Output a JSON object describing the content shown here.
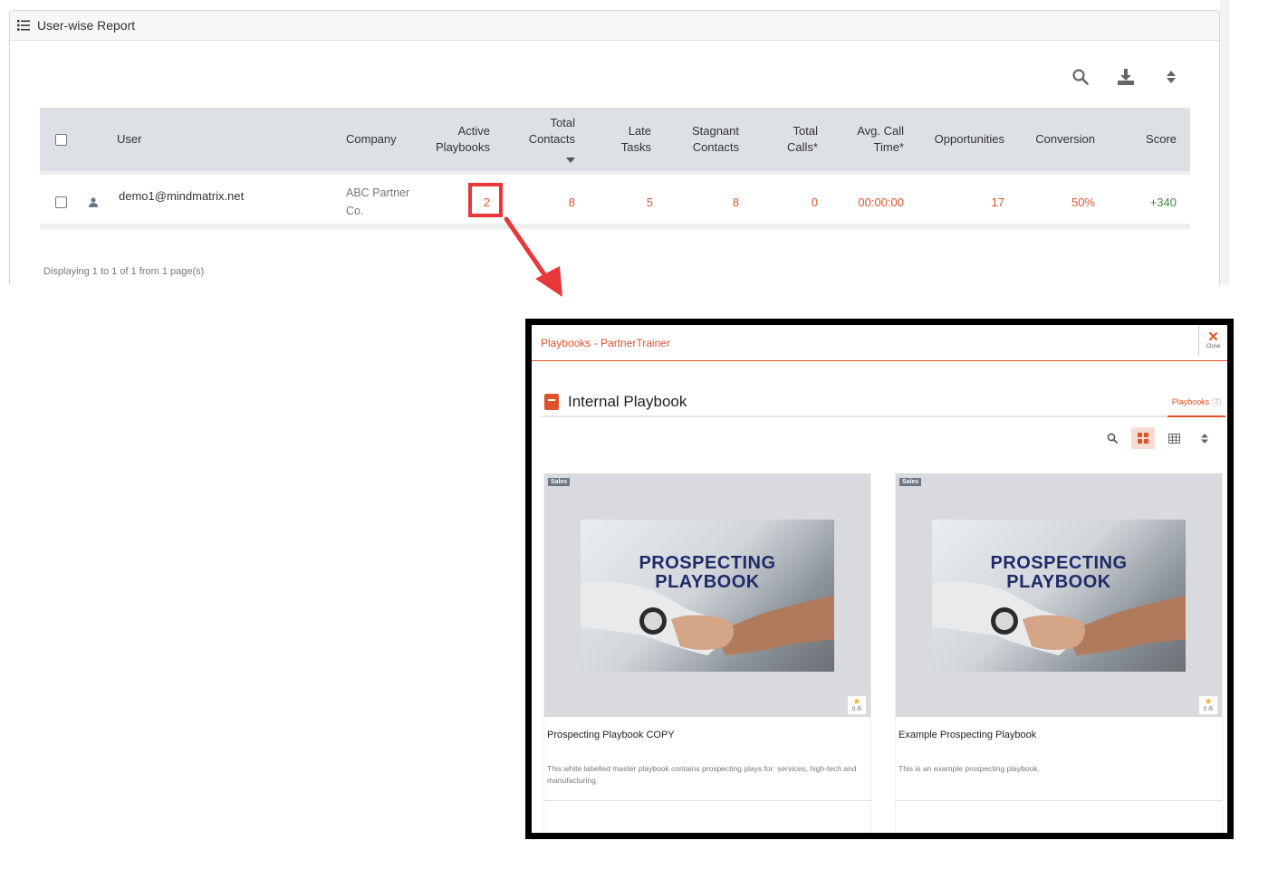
{
  "report": {
    "title": "User-wise Report",
    "columns": {
      "user": "User",
      "company": "Company",
      "active_playbooks": "Active\nPlaybooks",
      "total_contacts": "Total\nContacts",
      "late_tasks": "Late\nTasks",
      "stagnant_contacts": "Stagnant\nContacts",
      "total_calls": "Total\nCalls*",
      "avg_call_time": "Avg. Call\nTime*",
      "opportunities": "Opportunities",
      "conversion": "Conversion",
      "score": "Score"
    },
    "row": {
      "user": "demo1@mindmatrix.net",
      "company": "ABC Partner\nCo.",
      "active_playbooks": "2",
      "total_contacts": "8",
      "late_tasks": "5",
      "stagnant_contacts": "8",
      "total_calls": "0",
      "avg_call_time": "00:00:00",
      "opportunities": "17",
      "conversion": "50%",
      "score": "+340"
    },
    "footer": "Displaying 1 to 1 of 1 from 1 page(s)"
  },
  "modal": {
    "title": "Playbooks - PartnerTrainer",
    "close_label": "Close",
    "section_title": "Internal Playbook",
    "tab_label": "Playbooks",
    "tab_count": "2",
    "cards": [
      {
        "tag": "Sales",
        "thumb_text": "PROSPECTING\nPLAYBOOK",
        "rating": "0 /5",
        "name": "Prospecting Playbook COPY",
        "description": "This white labelled master playbook contains prospecting plays for: services, high-tech and manufacturing."
      },
      {
        "tag": "Sales",
        "thumb_text": "PROSPECTING\nPLAYBOOK",
        "rating": "0 /5",
        "name": "Example Prospecting Playbook",
        "description": "This is an example prospecting playbook."
      }
    ]
  },
  "colors": {
    "accent": "#e0522a",
    "highlight": "#e8363b",
    "header_bg": "#dde0e4",
    "score_green": "#3d8a3d"
  },
  "icons": [
    "list-icon",
    "search-icon",
    "download-icon",
    "sort-icon",
    "user-icon",
    "close-icon",
    "book-icon",
    "grid-view-icon",
    "table-view-icon",
    "star-icon"
  ]
}
